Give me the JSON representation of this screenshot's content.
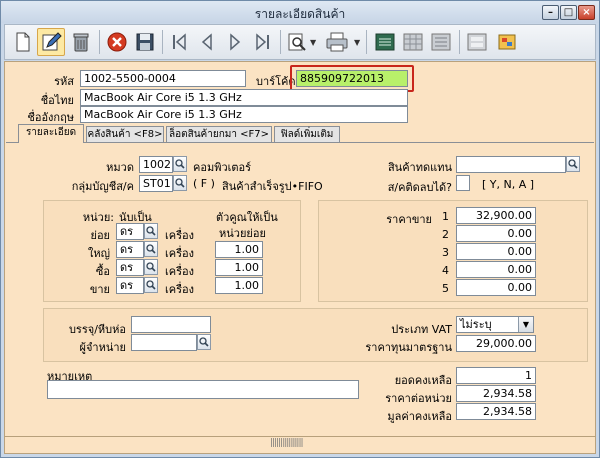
{
  "window": {
    "title": "รายละเอียดสินค้า"
  },
  "header": {
    "code_label": "รหัส",
    "code_value": "1002-5500-0004",
    "barcode_label": "บาร์โค้ด",
    "barcode_value": "885909722013",
    "thai_name_label": "ชื่อไทย",
    "thai_name_value": "MacBook Air Core i5 1.3 GHz",
    "eng_name_label": "ชื่ออังกฤษ",
    "eng_name_value": "MacBook Air Core i5 1.3 GHz"
  },
  "tabs": [
    {
      "label": "รายละเอียด"
    },
    {
      "label": "คลังสินค้า <F8>"
    },
    {
      "label": "ล็อตสินค้ายกมา <F7>"
    },
    {
      "label": "ฟิลด์เพิ่มเติม"
    }
  ],
  "details": {
    "category_label": "หมวด",
    "category_code": "1002",
    "category_name": "คอมพิวเตอร์",
    "account_group_label": "กลุ่มบัญชีส/ค",
    "account_group_code": "ST01",
    "account_group_flag": "( F )",
    "account_group_name": "สินค้าสำเร็จรูป•FIFO",
    "substitute_label": "สินค้าทดแทน",
    "substitute_value": "",
    "stock_count_label": "ส/คติดลบได้?",
    "stock_count_hint": "[ Y, N, A ]"
  },
  "units": {
    "unit_header": "หน่วย:",
    "as_header": "นับเป็น",
    "multiplier_header_1": "ตัวคูณให้เป็น",
    "multiplier_header_2": "หน่วยย่อย",
    "rows": [
      {
        "label": "ย่อย",
        "unit": "ดร",
        "suffix": "เครื่อง",
        "factor": ""
      },
      {
        "label": "ใหญ่",
        "unit": "ดร",
        "suffix": "เครื่อง",
        "factor": "1.00"
      },
      {
        "label": "ซื้อ",
        "unit": "ดร",
        "suffix": "เครื่อง",
        "factor": "1.00"
      },
      {
        "label": "ขาย",
        "unit": "ดร",
        "suffix": "เครื่อง",
        "factor": "1.00"
      }
    ]
  },
  "prices": {
    "label": "ราคาขาย",
    "rows": [
      {
        "num": "1",
        "value": "32,900.00"
      },
      {
        "num": "2",
        "value": "0.00"
      },
      {
        "num": "3",
        "value": "0.00"
      },
      {
        "num": "4",
        "value": "0.00"
      },
      {
        "num": "5",
        "value": "0.00"
      }
    ]
  },
  "packing": {
    "pack_label": "บรรจุ/หีบห่อ",
    "pack_value": "",
    "supplier_label": "ผู้จำหน่าย",
    "supplier_value": "",
    "vat_label": "ประเภท VAT",
    "vat_value": "ไม่ระบุ",
    "std_cost_label": "ราคาทุนมาตรฐาน",
    "std_cost_value": "29,000.00"
  },
  "notes": {
    "label": "หมายเหตุ",
    "value": ""
  },
  "balance": {
    "qty_label": "ยอดคงเหลือ",
    "qty_value": "1",
    "unit_cost_label": "ราคาต่อหน่วย",
    "unit_cost_value": "2,934.58",
    "remain_value_label": "มูลค่าคงเหลือ",
    "remain_value_value": "2,934.58"
  }
}
